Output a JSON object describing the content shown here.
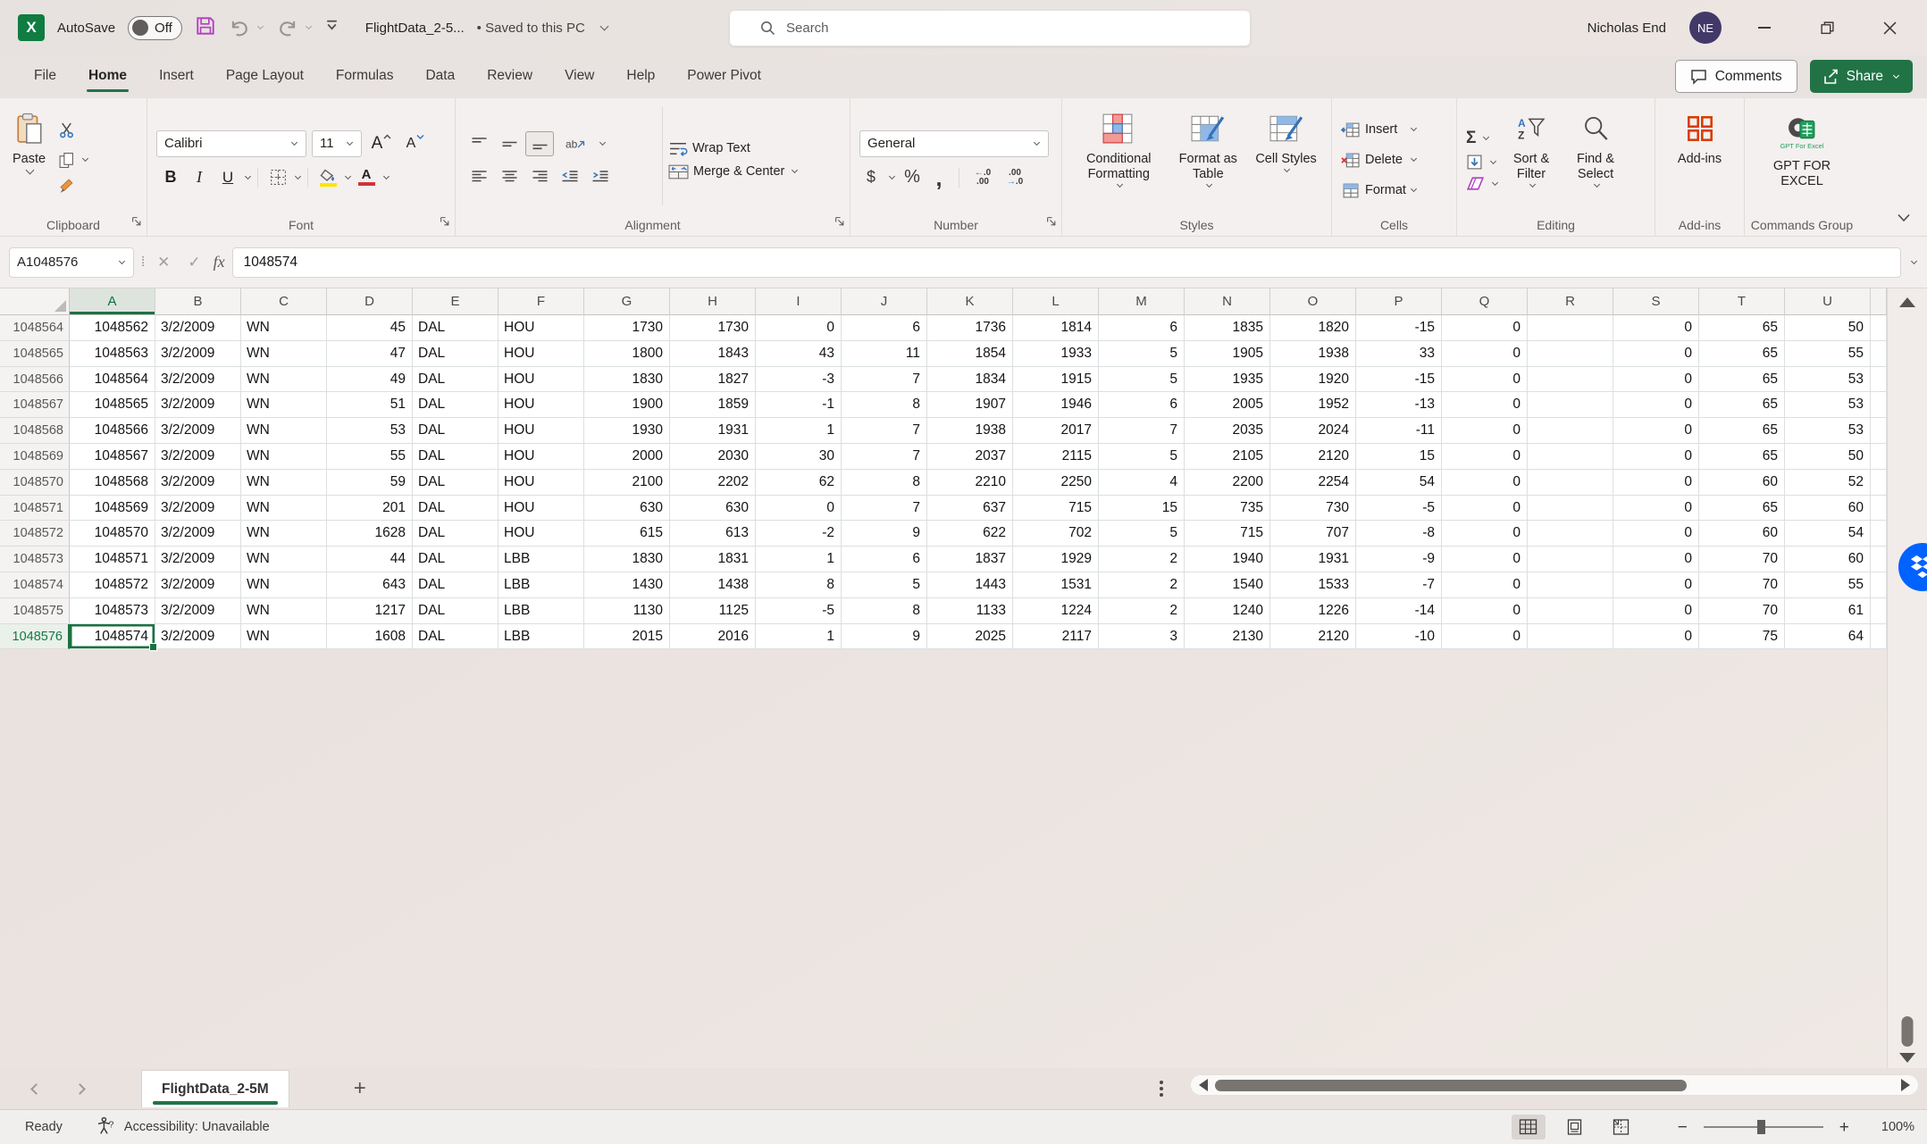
{
  "titlebar": {
    "autosave_label": "AutoSave",
    "autosave_state": "Off",
    "doc_title": "FlightData_2-5...",
    "saved_status": "• Saved to this PC",
    "search_placeholder": "Search",
    "user_name": "Nicholas End",
    "user_initials": "NE"
  },
  "ribbon_tabs": [
    "File",
    "Home",
    "Insert",
    "Page Layout",
    "Formulas",
    "Data",
    "Review",
    "View",
    "Help",
    "Power Pivot"
  ],
  "active_tab": "Home",
  "top_buttons": {
    "comments": "Comments",
    "share": "Share"
  },
  "ribbon": {
    "clipboard": {
      "label": "Clipboard",
      "paste": "Paste"
    },
    "font": {
      "label": "Font",
      "font_name": "Calibri",
      "font_size": "11"
    },
    "alignment": {
      "label": "Alignment",
      "wrap_text": "Wrap Text",
      "merge_center": "Merge & Center"
    },
    "number": {
      "label": "Number",
      "format": "General"
    },
    "styles": {
      "label": "Styles",
      "conditional_formatting": "Conditional Formatting",
      "format_as_table": "Format as Table",
      "cell_styles": "Cell Styles"
    },
    "cells": {
      "label": "Cells",
      "insert": "Insert",
      "delete": "Delete",
      "format": "Format"
    },
    "editing": {
      "label": "Editing",
      "sort_filter": "Sort & Filter",
      "find_select": "Find & Select"
    },
    "addins": {
      "label": "Add-ins",
      "button": "Add-ins"
    },
    "commands": {
      "label": "Commands Group",
      "button": "GPT FOR EXCEL",
      "icon_caption": "GPT For Excel"
    }
  },
  "glyphs": {
    "bold": "B",
    "italic": "I",
    "underline": "U",
    "autosum": "Σ",
    "dollar": "$",
    "percent": "%",
    "comma": ",",
    "fx": "fx",
    "font_grow": "A",
    "font_shrink": "A",
    "orientation": "ab",
    "new_sheet": "+"
  },
  "formula_bar": {
    "name_box": "A1048576",
    "formula": "1048574"
  },
  "grid": {
    "columns": [
      "A",
      "B",
      "C",
      "D",
      "E",
      "F",
      "G",
      "H",
      "I",
      "J",
      "K",
      "L",
      "M",
      "N",
      "O",
      "P",
      "Q",
      "R",
      "S",
      "T",
      "U"
    ],
    "col_align": [
      "right",
      "left",
      "left",
      "right",
      "left",
      "left",
      "right",
      "right",
      "right",
      "right",
      "right",
      "right",
      "right",
      "right",
      "right",
      "right",
      "right",
      "right",
      "right",
      "right",
      "right"
    ],
    "selected_column": "A",
    "selected_cell": {
      "row_header": "1048576",
      "column": "A"
    },
    "row_headers": [
      "1048564",
      "1048565",
      "1048566",
      "1048567",
      "1048568",
      "1048569",
      "1048570",
      "1048571",
      "1048572",
      "1048573",
      "1048574",
      "1048575",
      "1048576"
    ],
    "rows": [
      [
        "1048562",
        "3/2/2009",
        "WN",
        "45",
        "DAL",
        "HOU",
        "1730",
        "1730",
        "0",
        "6",
        "1736",
        "1814",
        "6",
        "1835",
        "1820",
        "-15",
        "0",
        "",
        "0",
        "65",
        "50"
      ],
      [
        "1048563",
        "3/2/2009",
        "WN",
        "47",
        "DAL",
        "HOU",
        "1800",
        "1843",
        "43",
        "11",
        "1854",
        "1933",
        "5",
        "1905",
        "1938",
        "33",
        "0",
        "",
        "0",
        "65",
        "55"
      ],
      [
        "1048564",
        "3/2/2009",
        "WN",
        "49",
        "DAL",
        "HOU",
        "1830",
        "1827",
        "-3",
        "7",
        "1834",
        "1915",
        "5",
        "1935",
        "1920",
        "-15",
        "0",
        "",
        "0",
        "65",
        "53"
      ],
      [
        "1048565",
        "3/2/2009",
        "WN",
        "51",
        "DAL",
        "HOU",
        "1900",
        "1859",
        "-1",
        "8",
        "1907",
        "1946",
        "6",
        "2005",
        "1952",
        "-13",
        "0",
        "",
        "0",
        "65",
        "53"
      ],
      [
        "1048566",
        "3/2/2009",
        "WN",
        "53",
        "DAL",
        "HOU",
        "1930",
        "1931",
        "1",
        "7",
        "1938",
        "2017",
        "7",
        "2035",
        "2024",
        "-11",
        "0",
        "",
        "0",
        "65",
        "53"
      ],
      [
        "1048567",
        "3/2/2009",
        "WN",
        "55",
        "DAL",
        "HOU",
        "2000",
        "2030",
        "30",
        "7",
        "2037",
        "2115",
        "5",
        "2105",
        "2120",
        "15",
        "0",
        "",
        "0",
        "65",
        "50"
      ],
      [
        "1048568",
        "3/2/2009",
        "WN",
        "59",
        "DAL",
        "HOU",
        "2100",
        "2202",
        "62",
        "8",
        "2210",
        "2250",
        "4",
        "2200",
        "2254",
        "54",
        "0",
        "",
        "0",
        "60",
        "52"
      ],
      [
        "1048569",
        "3/2/2009",
        "WN",
        "201",
        "DAL",
        "HOU",
        "630",
        "630",
        "0",
        "7",
        "637",
        "715",
        "15",
        "735",
        "730",
        "-5",
        "0",
        "",
        "0",
        "65",
        "60"
      ],
      [
        "1048570",
        "3/2/2009",
        "WN",
        "1628",
        "DAL",
        "HOU",
        "615",
        "613",
        "-2",
        "9",
        "622",
        "702",
        "5",
        "715",
        "707",
        "-8",
        "0",
        "",
        "0",
        "60",
        "54"
      ],
      [
        "1048571",
        "3/2/2009",
        "WN",
        "44",
        "DAL",
        "LBB",
        "1830",
        "1831",
        "1",
        "6",
        "1837",
        "1929",
        "2",
        "1940",
        "1931",
        "-9",
        "0",
        "",
        "0",
        "70",
        "60"
      ],
      [
        "1048572",
        "3/2/2009",
        "WN",
        "643",
        "DAL",
        "LBB",
        "1430",
        "1438",
        "8",
        "5",
        "1443",
        "1531",
        "2",
        "1540",
        "1533",
        "-7",
        "0",
        "",
        "0",
        "70",
        "55"
      ],
      [
        "1048573",
        "3/2/2009",
        "WN",
        "1217",
        "DAL",
        "LBB",
        "1130",
        "1125",
        "-5",
        "8",
        "1133",
        "1224",
        "2",
        "1240",
        "1226",
        "-14",
        "0",
        "",
        "0",
        "70",
        "61"
      ],
      [
        "1048574",
        "3/2/2009",
        "WN",
        "1608",
        "DAL",
        "LBB",
        "2015",
        "2016",
        "1",
        "9",
        "2025",
        "2117",
        "3",
        "2130",
        "2120",
        "-10",
        "0",
        "",
        "0",
        "75",
        "64"
      ]
    ]
  },
  "sheet_bar": {
    "active_tab": "FlightData_2-5M"
  },
  "status_bar": {
    "mode": "Ready",
    "accessibility": "Accessibility: Unavailable",
    "zoom_level": "100%"
  },
  "colors": {
    "brand_green": "#217346",
    "selection_green": "#1a7240",
    "dropbox_blue": "#0062ff",
    "fill_yellow": "#ffe400",
    "font_red": "#d13438",
    "addins_orange": "#d83b01"
  }
}
